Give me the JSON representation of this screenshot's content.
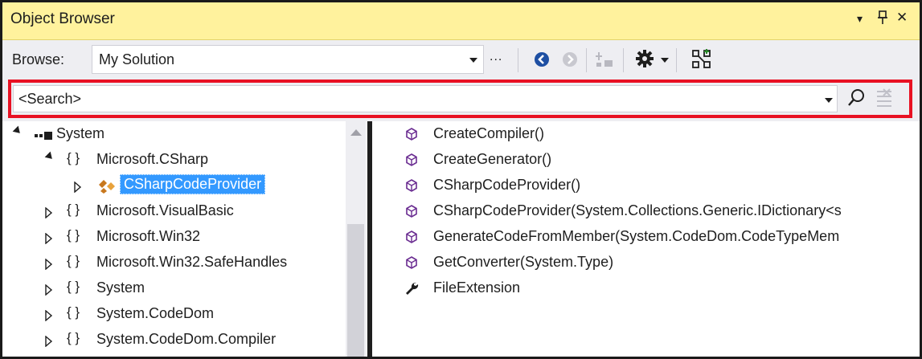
{
  "window": {
    "title": "Object Browser",
    "title_controls": [
      "▾",
      "ᵖ",
      "✕"
    ]
  },
  "toolbar": {
    "browse_label": "Browse:",
    "browse_value": "My Solution",
    "ellipsis": "..."
  },
  "search": {
    "value": "<Search>"
  },
  "tree": {
    "root": "System",
    "items": [
      {
        "label": "Microsoft.CSharp",
        "expanded": true
      },
      {
        "label": "CSharpCodeProvider",
        "selected": true
      },
      {
        "label": "Microsoft.VisualBasic"
      },
      {
        "label": "Microsoft.Win32"
      },
      {
        "label": "Microsoft.Win32.SafeHandles"
      },
      {
        "label": "System"
      },
      {
        "label": "System.CodeDom"
      },
      {
        "label": "System.CodeDom.Compiler"
      }
    ],
    "ns_glyph": "{ }"
  },
  "members": [
    {
      "label": "CreateCompiler()",
      "icon": "method-icon"
    },
    {
      "label": "CreateGenerator()",
      "icon": "method-icon"
    },
    {
      "label": "CSharpCodeProvider()",
      "icon": "method-icon"
    },
    {
      "label": "CSharpCodeProvider(System.Collections.Generic.IDictionary<s",
      "icon": "method-icon"
    },
    {
      "label": "GenerateCodeFromMember(System.CodeDom.CodeTypeMem",
      "icon": "method-icon"
    },
    {
      "label": "GetConverter(System.Type)",
      "icon": "method-icon"
    },
    {
      "label": "FileExtension",
      "icon": "property-wrench-icon"
    }
  ],
  "colors": {
    "titlebar": "#fff29d",
    "highlight": "#e81123",
    "selection": "#3399ff",
    "accent": "#1e4fa3",
    "method": "#6a2c91"
  }
}
